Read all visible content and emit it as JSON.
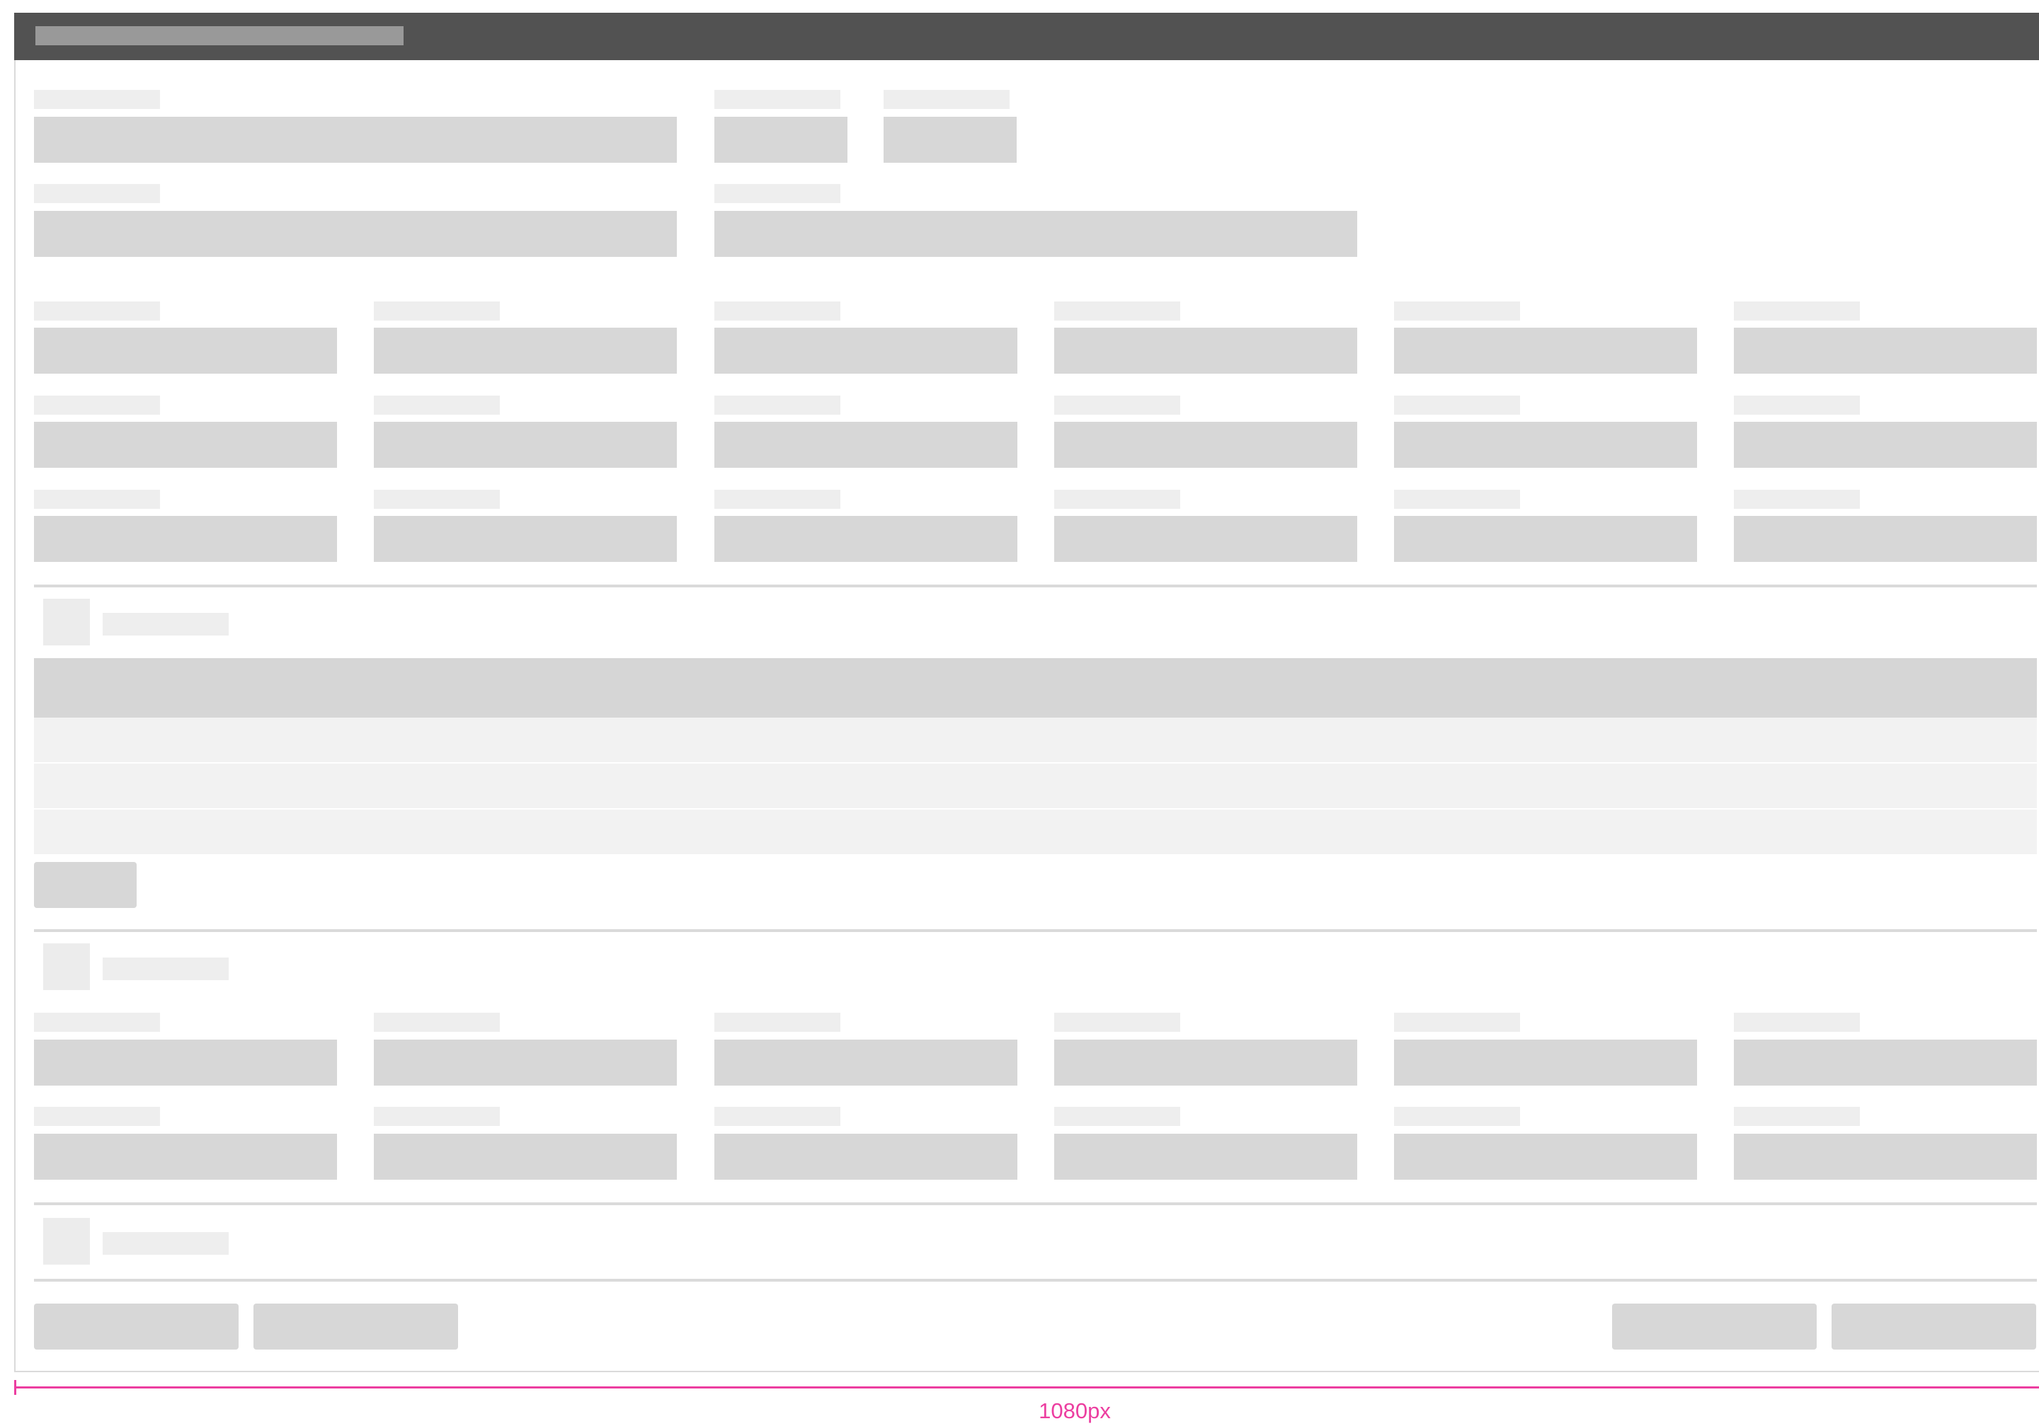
{
  "window": {
    "title": ""
  },
  "form": {
    "top_row_1": [
      "",
      "",
      ""
    ],
    "top_row_2": [
      "",
      ""
    ],
    "grid_rows": [
      [
        "",
        "",
        "",
        "",
        "",
        ""
      ],
      [
        "",
        "",
        "",
        "",
        "",
        ""
      ],
      [
        "",
        "",
        "",
        "",
        "",
        ""
      ]
    ]
  },
  "section_table": {
    "title": "",
    "row_count": 3,
    "add_button_label": ""
  },
  "section_details": {
    "title": "",
    "grid_rows": [
      [
        "",
        "",
        "",
        "",
        "",
        ""
      ],
      [
        "",
        "",
        "",
        "",
        "",
        ""
      ]
    ]
  },
  "section_collapsed": {
    "title": ""
  },
  "footer": {
    "left_buttons": [
      "",
      ""
    ],
    "right_buttons": [
      "",
      ""
    ]
  },
  "annotation": {
    "width_label": "1080px"
  },
  "colors": {
    "titlebar": "#525252",
    "field_placeholder": "#d7d7d7",
    "label_placeholder": "#eeeeee",
    "annotation": "#ec3ea0"
  }
}
